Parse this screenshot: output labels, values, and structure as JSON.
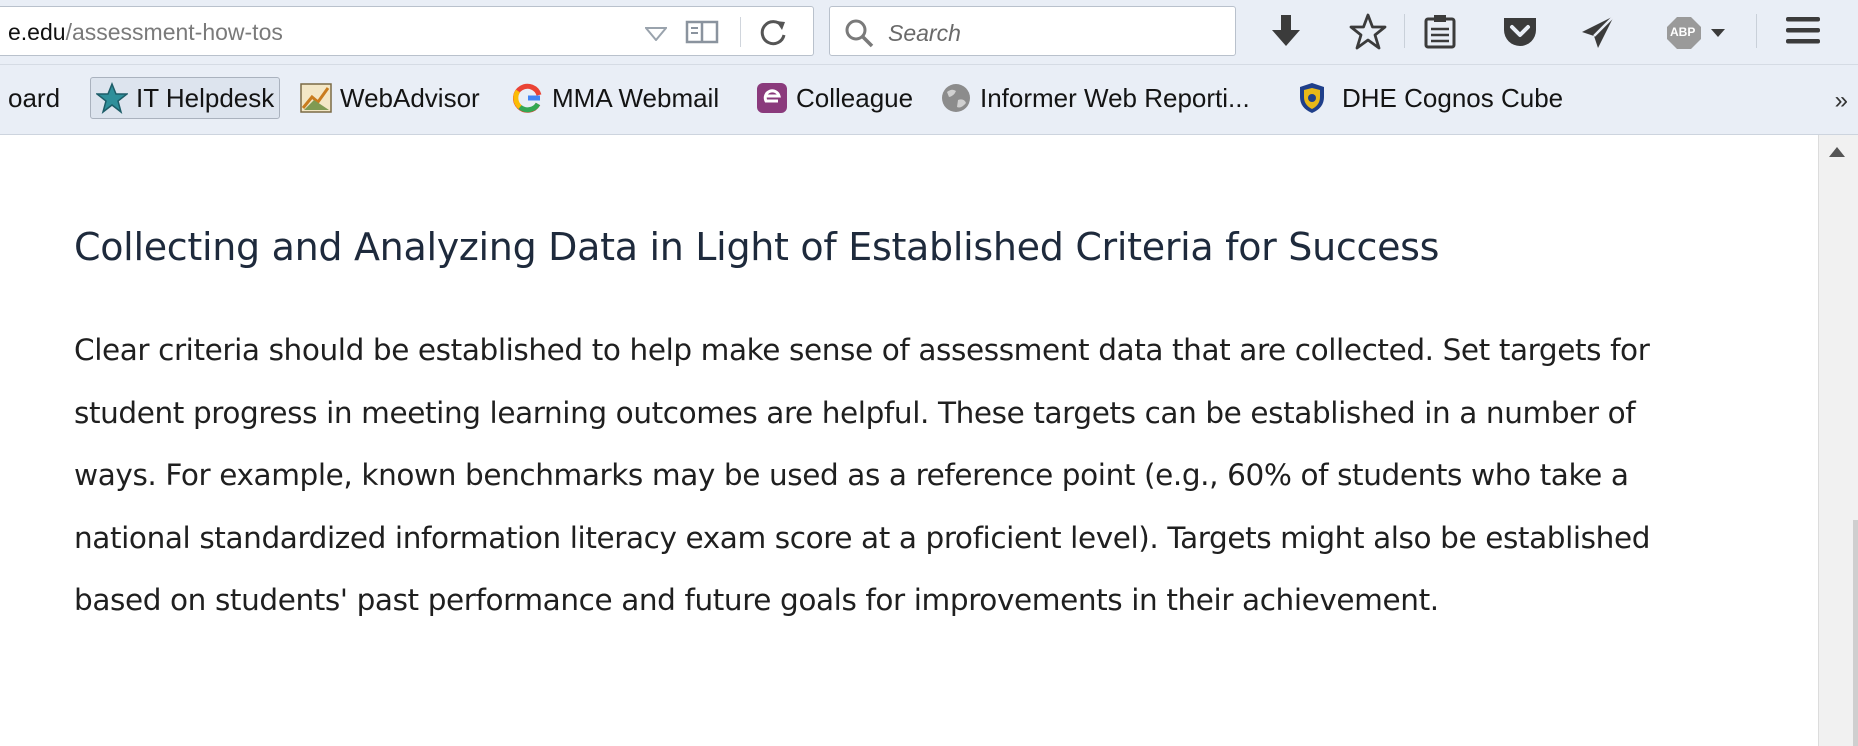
{
  "toolbar": {
    "url_host": "e.edu",
    "url_path": "/assessment-how-tos",
    "search_placeholder": "Search",
    "adblock_label": "ABP"
  },
  "bookmarks": {
    "items": [
      {
        "label": "oard",
        "icon": "none"
      },
      {
        "label": "IT Helpdesk",
        "icon": "star-icon"
      },
      {
        "label": "WebAdvisor",
        "icon": "webadvisor-icon"
      },
      {
        "label": "MMA Webmail",
        "icon": "google-icon"
      },
      {
        "label": "Colleague",
        "icon": "colleague-icon"
      },
      {
        "label": "Informer Web Reporti...",
        "icon": "globe-icon"
      },
      {
        "label": "DHE Cognos Cube",
        "icon": "shield-icon"
      }
    ],
    "overflow": "»"
  },
  "content": {
    "heading": "Collecting and Analyzing Data in Light of Established Criteria for Success",
    "paragraph": "Clear criteria should be established to help make sense of assessment data that are collected. Set targets for student progress in meeting learning outcomes are helpful. These targets can be established in a number of ways. For example, known benchmarks may be used as a reference point (e.g., 60% of students who take a national standardized information literacy exam score at a proficient level). Targets might also be established based on students' past performance and future goals for improvements in their achievement."
  },
  "colors": {
    "chrome": "#e9eef6",
    "heading": "#1e2a3c",
    "text": "#1f1f1f",
    "colleague_purple": "#8a3a7c"
  }
}
